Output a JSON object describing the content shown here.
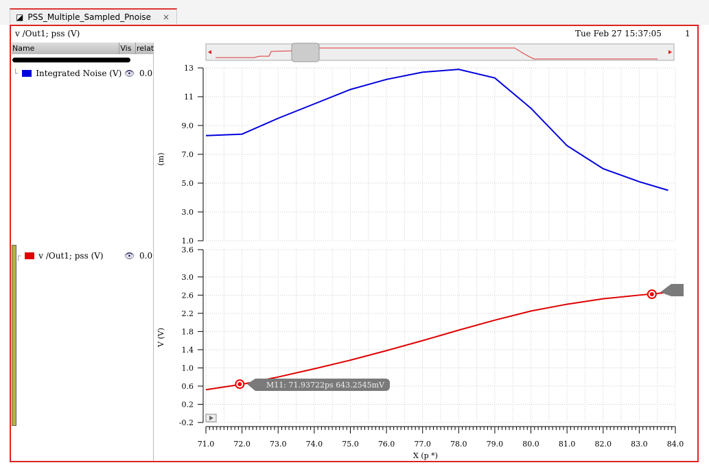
{
  "tab": {
    "title": "PSS_Multiple_Sampled_Pnoise",
    "close": "×"
  },
  "header": {
    "title": "v /Out1; pss (V)",
    "date": "Tue Feb 27 15:37:05",
    "page": "1"
  },
  "legend": {
    "columns": [
      "Name",
      "Vis",
      "relat"
    ],
    "signals": [
      {
        "name": "Integrated Noise (V)",
        "value": "0.0",
        "color": "#0000dd"
      },
      {
        "name": "v /Out1; pss (V)",
        "value": "0.0",
        "color": "#dd0000"
      }
    ]
  },
  "marker": {
    "label": "M11: 71.93722ps 643.2545mV",
    "x": 71.93722,
    "y": 0.6432545
  },
  "chart_data": [
    {
      "type": "line",
      "ylabel": "(m)",
      "ylim": [
        1.0,
        13
      ],
      "yticks": [
        "13",
        "11",
        "9.0",
        "7.0",
        "5.0",
        "3.0",
        "1.0"
      ],
      "xlim": [
        71,
        84
      ],
      "series": [
        {
          "name": "Integrated Noise (V)",
          "color": "#0000dd",
          "x": [
            71,
            72,
            73,
            74,
            75,
            76,
            77,
            78,
            79,
            80,
            81,
            82,
            83,
            83.8
          ],
          "y": [
            8.3,
            8.4,
            9.5,
            10.5,
            11.5,
            12.2,
            12.7,
            12.9,
            12.3,
            10.2,
            7.6,
            6.0,
            5.1,
            4.5
          ]
        }
      ]
    },
    {
      "type": "line",
      "ylabel": "V (V)",
      "xlabel": "X (p *)",
      "ylim": [
        -0.2,
        3.6
      ],
      "yticks": [
        "3.6",
        "3.0",
        "2.6",
        "2.2",
        "1.8",
        "1.4",
        "1.0",
        "0.6",
        "0.2",
        "-0.2"
      ],
      "xlim": [
        71,
        84
      ],
      "xticks": [
        "71.0",
        "72.0",
        "73.0",
        "74.0",
        "75.0",
        "76.0",
        "77.0",
        "78.0",
        "79.0",
        "80.0",
        "81.0",
        "82.0",
        "83.0",
        "84.0"
      ],
      "series": [
        {
          "name": "v /Out1; pss (V)",
          "color": "#dd0000",
          "x": [
            71,
            72,
            73,
            74,
            75,
            76,
            77,
            78,
            79,
            80,
            81,
            82,
            83,
            83.8
          ],
          "y": [
            0.52,
            0.64,
            0.8,
            0.98,
            1.17,
            1.38,
            1.6,
            1.83,
            2.05,
            2.25,
            2.4,
            2.52,
            2.6,
            2.66
          ]
        }
      ]
    }
  ]
}
